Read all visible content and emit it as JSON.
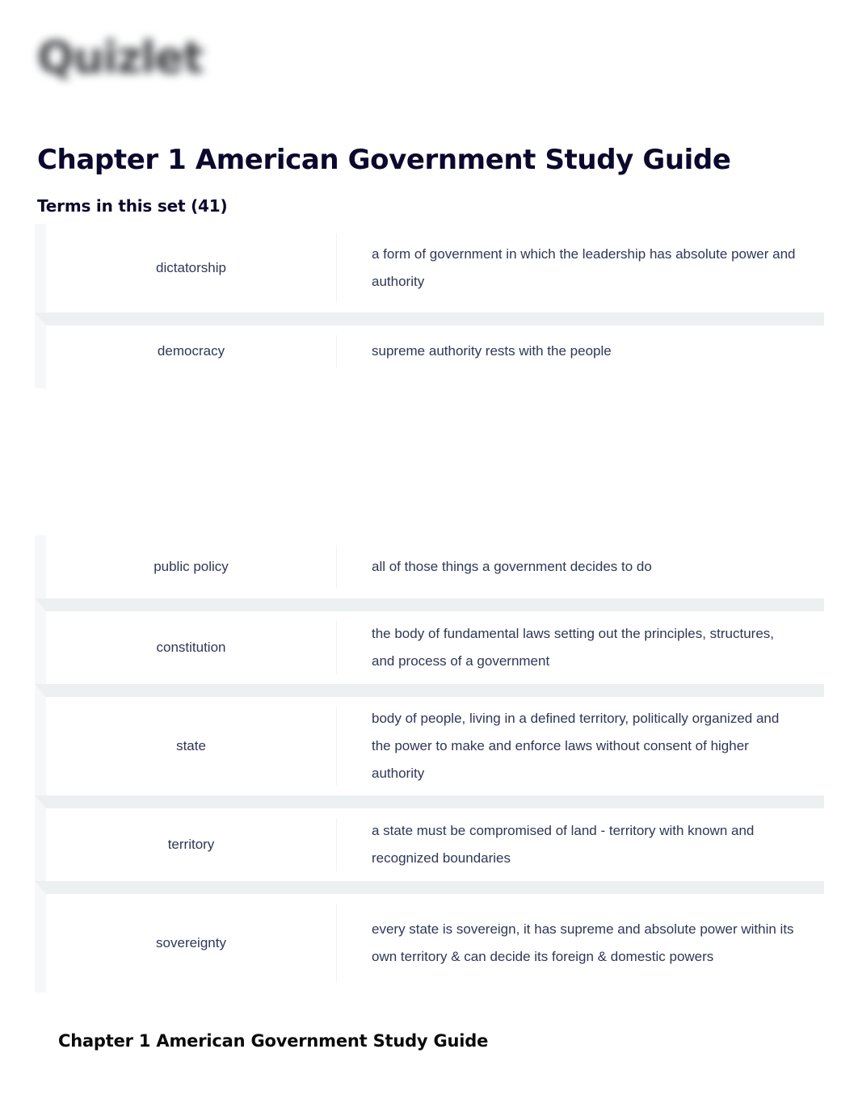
{
  "brand": {
    "logo_text": "Quizlet",
    "logo_state": "blurred"
  },
  "header": {
    "title": "Chapter 1 American Government Study Guide",
    "subtitle": "Terms in this set (41)",
    "term_count": 41
  },
  "terms_groups": [
    {
      "id": "group-a",
      "rows": [
        {
          "term": "dictatorship",
          "definition": "a form of government in which the leadership has absolute power and authority"
        },
        {
          "term": "democracy",
          "definition": "supreme authority rests with the people"
        }
      ]
    },
    {
      "id": "group-b",
      "rows": [
        {
          "term": "public policy",
          "definition": "all of those things a government decides to do"
        },
        {
          "term": "constitution",
          "definition": "the body of fundamental laws setting out the principles, structures, and process of a government"
        },
        {
          "term": "state",
          "definition": "body of people, living in a defined territory, politically organized and the power to make and enforce laws without consent of higher authority"
        },
        {
          "term": "territory",
          "definition": "a state must be compromised of land - territory with known and recognized boundaries"
        },
        {
          "term": "sovereignty",
          "definition": "every state is sovereign, it has supreme and absolute power within its own territory & can decide its foreign & domestic powers"
        }
      ]
    }
  ],
  "footer": {
    "title": "Chapter 1 American Government Study Guide"
  },
  "colors": {
    "text_primary": "#0a092d",
    "text_body": "#2e3856",
    "row_separator": "#edf0f1",
    "row_gutter": "#f6f7f8",
    "page_background": "#ffffff"
  }
}
